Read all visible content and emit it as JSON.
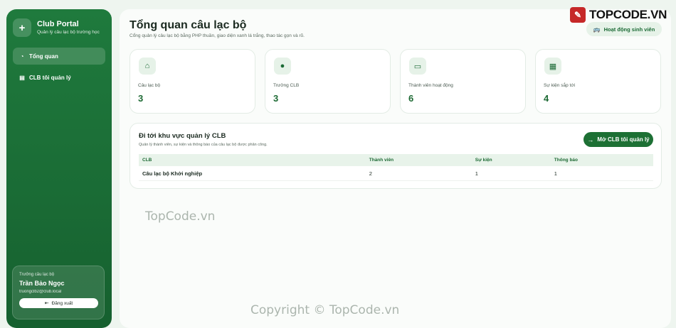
{
  "sidebar": {
    "brand_title": "Club Portal",
    "brand_subtitle": "Quản lý câu lạc bộ trường học",
    "nav": [
      {
        "label": "Tổng quan",
        "icon": "dashboard-icon"
      },
      {
        "label": "CLB tôi quản lý",
        "icon": "clipboard-icon"
      }
    ],
    "user": {
      "role": "Trưởng câu lạc bộ",
      "name": "Trần Bảo Ngọc",
      "email": "truongclb2@club.local",
      "logout_label": "Đăng xuất"
    }
  },
  "header": {
    "title": "Tổng quan câu lạc bộ",
    "subtitle": "Cổng quản lý câu lạc bộ bằng PHP thuần, giao diện xanh lá trắng, thao tác gọn và rõ.",
    "activity_label": "Hoạt động sinh viên"
  },
  "stats": [
    {
      "label": "Câu lạc bộ",
      "value": "3",
      "icon": "club-icon"
    },
    {
      "label": "Trưởng CLB",
      "value": "3",
      "icon": "user-icon"
    },
    {
      "label": "Thành viên hoạt động",
      "value": "6",
      "icon": "id-card-icon"
    },
    {
      "label": "Sự kiện sắp tới",
      "value": "4",
      "icon": "calendar-icon"
    }
  ],
  "management": {
    "title": "Đi tới khu vực quản lý CLB",
    "subtitle": "Quản lý thành viên, sự kiện và thông báo của câu lạc bộ được phân công.",
    "open_button": "Mở CLB tôi quản lý",
    "columns": [
      "CLB",
      "Thành viên",
      "Sự kiện",
      "Thông báo"
    ],
    "rows": [
      {
        "club": "Câu lạc bộ Khởi nghiệp",
        "members": "2",
        "events": "1",
        "notices": "1"
      }
    ]
  },
  "watermarks": {
    "logo_text": "TOPCODE.VN",
    "center": "TopCode.vn",
    "bottom": "Copyright © TopCode.vn"
  },
  "colors": {
    "sidebar": "#1f7a3d",
    "accent": "#1d7034",
    "background": "#eef5ef"
  }
}
